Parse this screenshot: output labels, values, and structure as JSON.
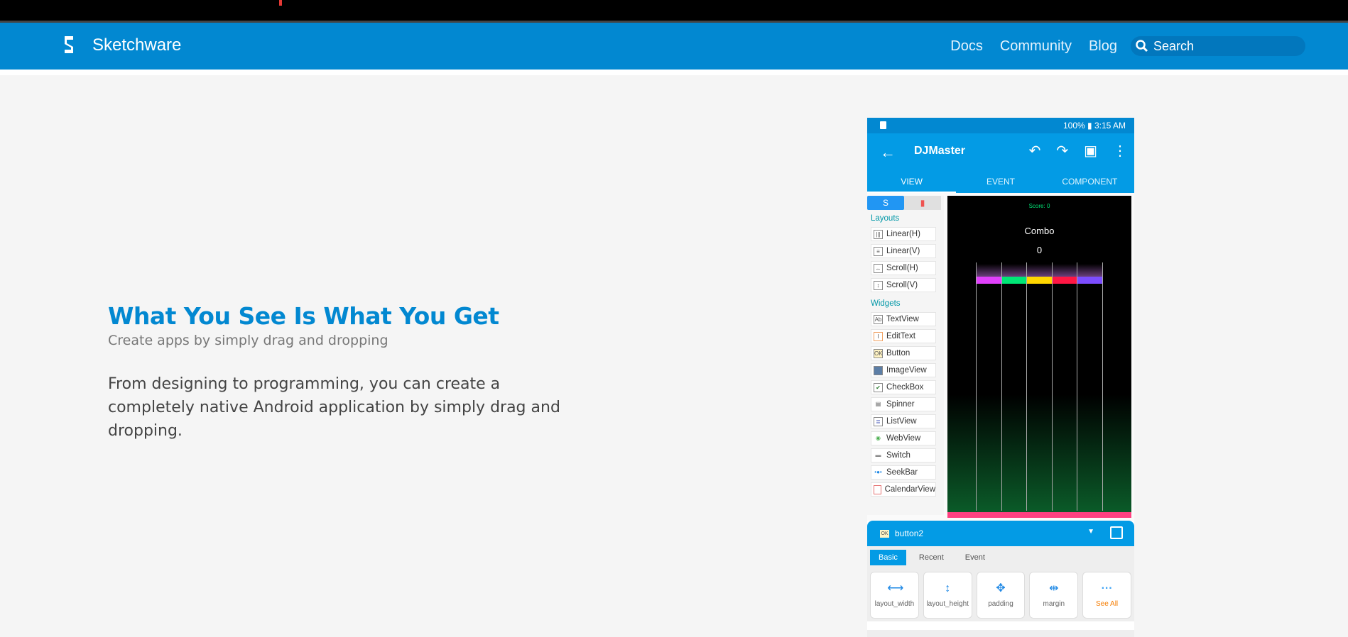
{
  "site": {
    "brand": "Sketchware",
    "nav": [
      "Docs",
      "Community",
      "Blog"
    ],
    "search_placeholder": "Search",
    "colors": {
      "primary": "#0288d1",
      "heading": "#0288d1"
    }
  },
  "hero": {
    "title": "What You See Is What You Get",
    "subtitle": "Create apps by simply drag and dropping",
    "body": "From designing to programming, you can create a completely native Android application by simply drag and dropping."
  },
  "phone": {
    "status": "100% ▮ 3:15 AM",
    "app_title": "DJMaster",
    "tabs": [
      "VIEW",
      "EVENT",
      "COMPONENT"
    ],
    "palette_tab_icon": "S",
    "layouts_header": "Layouts",
    "layouts": [
      "Linear(H)",
      "Linear(V)",
      "Scroll(H)",
      "Scroll(V)"
    ],
    "widgets_header": "Widgets",
    "widgets": [
      "TextView",
      "EditText",
      "Button",
      "ImageView",
      "CheckBox",
      "Spinner",
      "ListView",
      "WebView",
      "Switch",
      "SeekBar",
      "CalendarView"
    ],
    "game": {
      "score": "Score: 0",
      "combo": "Combo",
      "count": "0",
      "keys": [
        "#e040fb",
        "#00e676",
        "#ffd600",
        "#ff1744",
        "#7c4dff"
      ]
    },
    "props": {
      "component": "button2",
      "tabs": [
        "Basic",
        "Recent",
        "Event"
      ],
      "buttons": [
        "layout_width",
        "layout_height",
        "padding",
        "margin",
        "See All"
      ]
    }
  }
}
